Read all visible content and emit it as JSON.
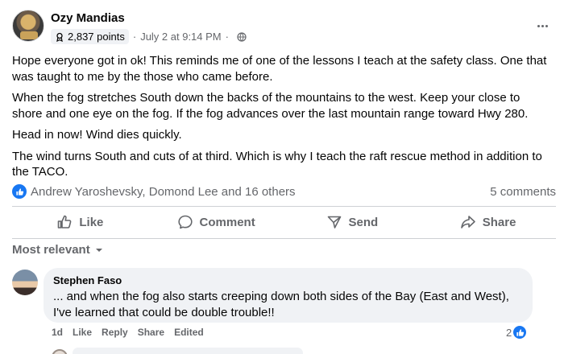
{
  "post": {
    "author": "Ozy Mandias",
    "points": "2,837 points",
    "timestamp": "July 2 at 9:14 PM",
    "paragraphs": [
      "Hope everyone got in ok! This reminds me of one of the lessons I teach at the safety class. One that was taught to me by the those who came before.",
      "When the fog stretches South down the backs of the mountains to the west. Keep your close to shore and one eye on the fog. If the fog advances over the last mountain range toward Hwy 280.",
      "Head in now! Wind dies quickly.",
      "The wind turns South and cuts of at third. Which is why I teach the raft rescue method in addition to the TACO."
    ],
    "reactions_text": "Andrew Yaroshevsky, Domond Lee and 16 others",
    "comments_count": "5 comments"
  },
  "actions": {
    "like": "Like",
    "comment": "Comment",
    "send": "Send",
    "share": "Share"
  },
  "comments": {
    "sort_label": "Most relevant",
    "first": {
      "author": "Stephen Faso",
      "text": "... and when the fog also starts creeping down both sides of the Bay (East and West), I've learned that could be double trouble!!",
      "age": "1d",
      "like": "Like",
      "reply": "Reply",
      "share": "Share",
      "edited": "Edited",
      "reaction_count": "2"
    }
  },
  "colors": {
    "accent": "#1877f2",
    "secondary_text": "#65676b",
    "bubble_bg": "#f0f2f5"
  }
}
